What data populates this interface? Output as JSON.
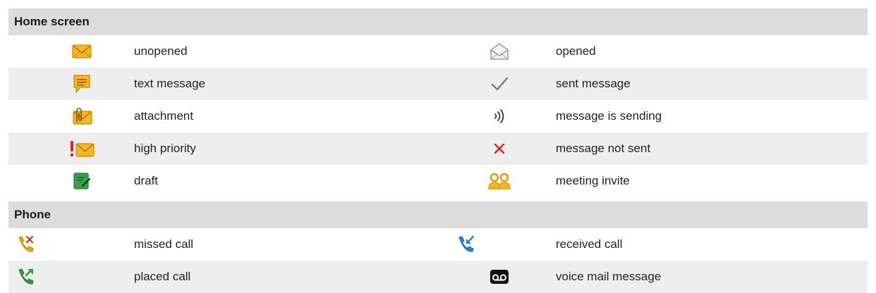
{
  "sections": {
    "home": {
      "title": "Home screen",
      "rows": [
        {
          "left": {
            "icon": "envelope-closed-icon",
            "label": "unopened"
          },
          "right": {
            "icon": "envelope-open-icon",
            "label": "opened"
          }
        },
        {
          "left": {
            "icon": "text-message-icon",
            "label": "text message"
          },
          "right": {
            "icon": "checkmark-icon",
            "label": "sent message"
          }
        },
        {
          "left": {
            "icon": "attachment-envelope-icon",
            "label": "attachment"
          },
          "right": {
            "icon": "sending-waves-icon",
            "label": "message is sending"
          }
        },
        {
          "left": {
            "icon": "high-priority-envelope-icon",
            "label": "high priority"
          },
          "right": {
            "icon": "red-x-icon",
            "label": "message not sent"
          }
        },
        {
          "left": {
            "icon": "draft-icon",
            "label": "draft"
          },
          "right": {
            "icon": "meeting-people-icon",
            "label": "meeting invite"
          }
        }
      ]
    },
    "phone": {
      "title": "Phone",
      "rows": [
        {
          "left": {
            "icon": "missed-call-icon",
            "label": "missed call"
          },
          "right": {
            "icon": "received-call-icon",
            "label": "received call"
          }
        },
        {
          "left": {
            "icon": "placed-call-icon",
            "label": "placed call"
          },
          "right": {
            "icon": "voicemail-icon",
            "label": "voice mail message"
          }
        }
      ]
    }
  },
  "colors": {
    "header_bg": "#dcdcdc",
    "row_shade": "#eeeeee",
    "envelope_yellow": "#f5b622",
    "priority_red": "#e02020",
    "draft_green": "#3aa14a",
    "call_orange": "#f0a500",
    "call_blue": "#2a7fd6",
    "call_green": "#2e9e3e"
  }
}
